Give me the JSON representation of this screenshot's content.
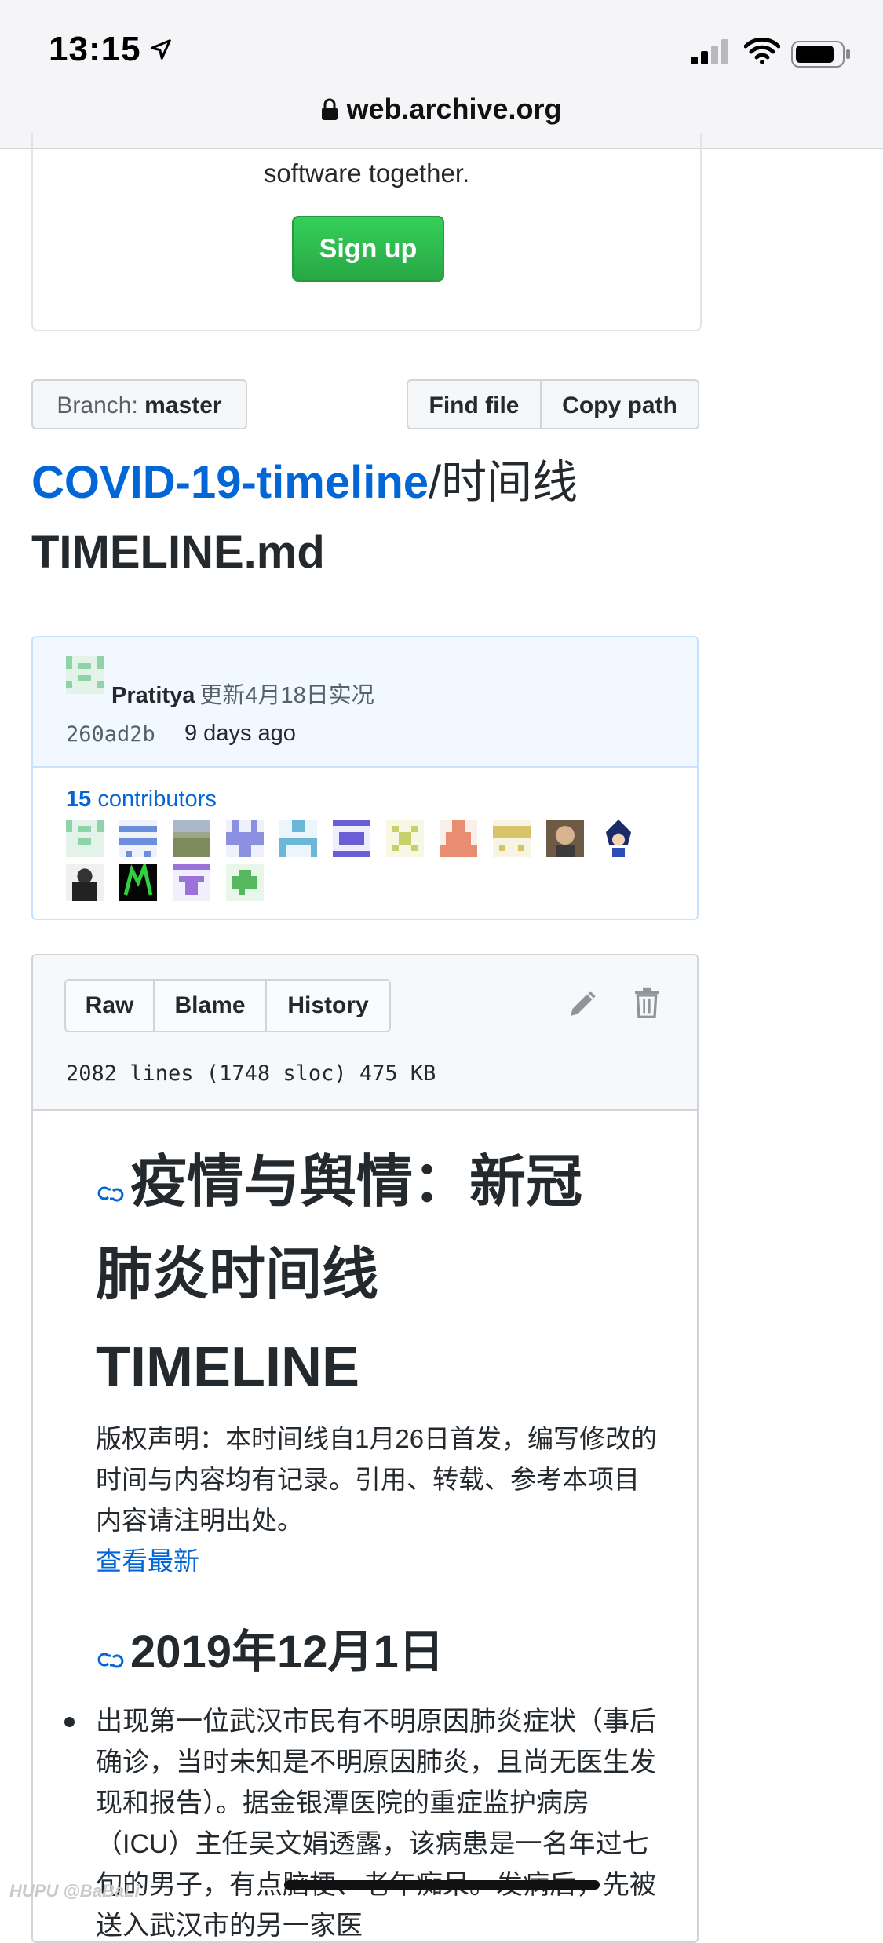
{
  "status": {
    "time": "13:15"
  },
  "browser": {
    "url": "web.archive.org"
  },
  "signup": {
    "text": "software together.",
    "button": "Sign up"
  },
  "toolbar": {
    "branch_label": "Branch:",
    "branch_value": "master",
    "find_file": "Find file",
    "copy_path": "Copy path"
  },
  "breadcrumb": {
    "repo": "COVID-19-timeline",
    "path": "/时间线",
    "filename": "TIMELINE.md"
  },
  "commit": {
    "author": "Pratitya",
    "message": "更新4月18日实况",
    "sha": "260ad2b",
    "age": "9 days ago",
    "contributors_count": "15",
    "contributors_label": " contributors"
  },
  "file": {
    "raw": "Raw",
    "blame": "Blame",
    "history": "History",
    "info": "2082 lines (1748 sloc) 475 KB"
  },
  "content": {
    "h1_line1": "疫情与舆情：新冠",
    "h1_line2": "肺炎时间线",
    "h1_line3": "TIMELINE",
    "copyright": "版权声明：本时间线自1月26日首发，编写修改的时间与内容均有记录。引用、转载、参考本项目内容请注明出处。",
    "latest_link": "查看最新",
    "h2": "2019年12月1日",
    "bullet1": "出现第一位武汉市民有不明原因肺炎症状（事后确诊，当时未知是不明原因肺炎，且尚无医生发现和报告）。据金银潭医院的重症监护病房（ICU）主任吴文娟透露，该病患是一名年过七旬的男子，有点脑梗、老年痴呆。发病后，先被送入武汉市的另一家医"
  },
  "watermark": "HUPU @BaBaLi"
}
